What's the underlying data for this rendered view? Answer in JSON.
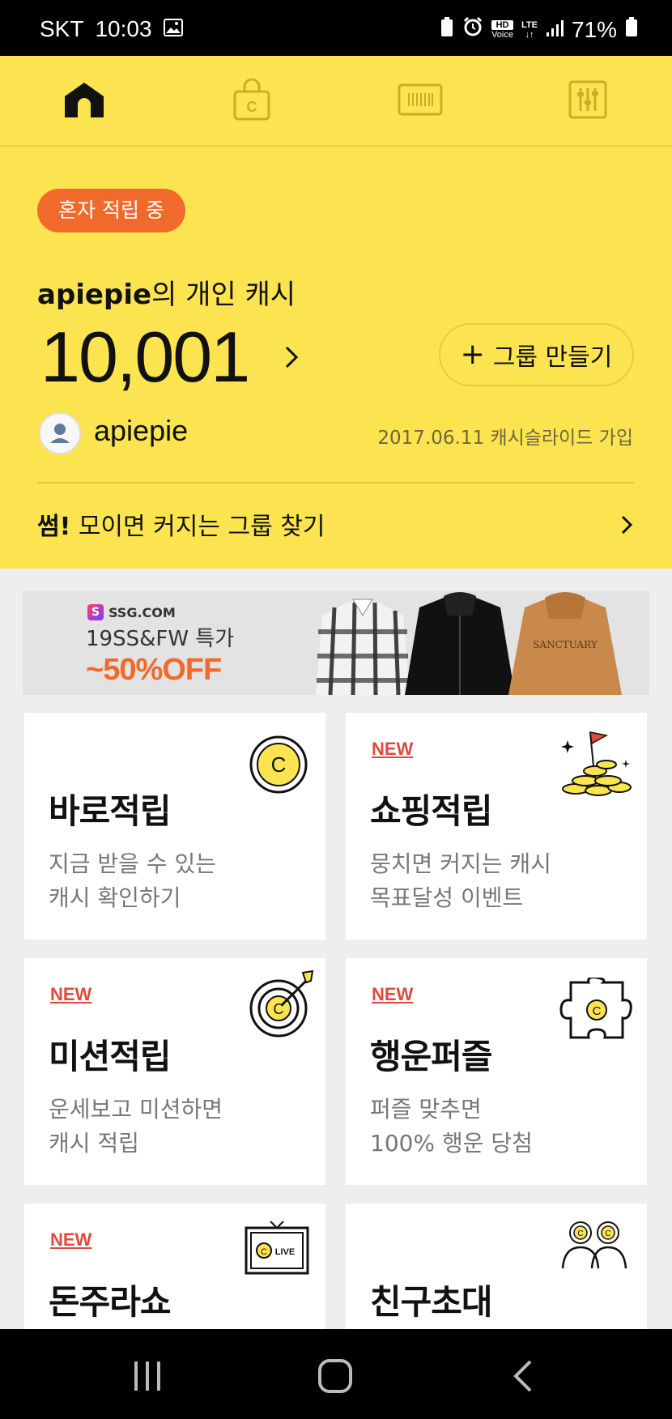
{
  "status_bar": {
    "carrier": "SKT",
    "time": "10:03",
    "battery": "71%",
    "network": "LTE",
    "hd_label": "HD",
    "voice_label": "Voice"
  },
  "tabs": [
    {
      "name": "home",
      "icon": "home-icon",
      "active": true
    },
    {
      "name": "shop",
      "icon": "shopping-bag-icon",
      "active": false
    },
    {
      "name": "barcode",
      "icon": "barcode-icon",
      "active": false
    },
    {
      "name": "settings",
      "icon": "sliders-icon",
      "active": false
    }
  ],
  "hero": {
    "badge": "혼자 적립 중",
    "owner_name": "apiepie",
    "owner_suffix": "의 개인 캐시",
    "amount": "10,001",
    "group_button": "그룹 만들기",
    "username": "apiepie",
    "joined": "2017.06.11 캐시슬라이드 가입",
    "find_group_bold": "썸!",
    "find_group_text": " 모이면 커지는 그룹 찾기"
  },
  "banner": {
    "brand": "SSG.COM",
    "title": "19SS&FW 특가",
    "discount": "~50%OFF"
  },
  "cards": [
    {
      "new": "",
      "title": "바로적립",
      "desc1": "지금 받을 수 있는",
      "desc2": "캐시 확인하기",
      "icon": "coin-icon"
    },
    {
      "new": "NEW",
      "title": "쇼핑적립",
      "desc1": "뭉치면 커지는 캐시",
      "desc2": "목표달성 이벤트",
      "icon": "coin-pile-flag-icon"
    },
    {
      "new": "NEW",
      "title": "미션적립",
      "desc1": "운세보고 미션하면",
      "desc2": "캐시 적립",
      "icon": "target-icon"
    },
    {
      "new": "NEW",
      "title": "행운퍼즐",
      "desc1": "퍼즐 맞추면",
      "desc2": "100% 행운 당첨",
      "icon": "puzzle-icon"
    },
    {
      "new": "NEW",
      "title": "돈주라쇼",
      "desc1": "",
      "desc2": "",
      "icon": "live-tv-icon"
    },
    {
      "new": "",
      "title": "친구초대",
      "desc1": "",
      "desc2": "",
      "icon": "friends-icon"
    }
  ],
  "colors": {
    "accent_yellow": "#fbe44f",
    "badge_orange": "#f26a2b",
    "new_red": "#e0493f"
  },
  "live_label": "LIVE"
}
